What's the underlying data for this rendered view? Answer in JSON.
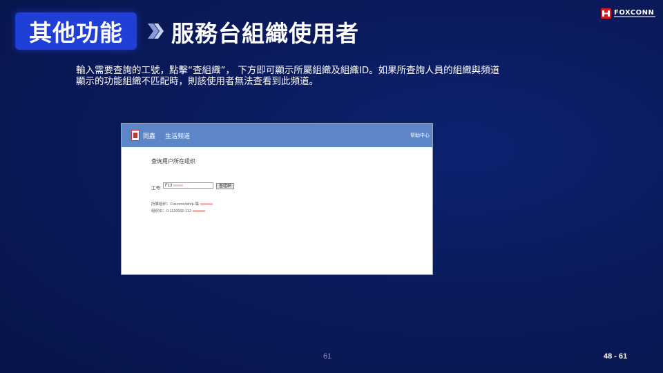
{
  "header": {
    "section_tag": "其他功能",
    "title": "服務台組織使用者",
    "brand": "FOXCONN"
  },
  "description": {
    "line1": "輸入需要查詢的工號，點擊“查組織”， 下方即可顯示所屬組織及組織ID。如果所查詢人員的組織與頻道",
    "line2": "顯示的功能組織不匹配時，則該使用者無法查看到此頻道。"
  },
  "screenshot": {
    "brand": "同鑫",
    "channel": "生活频道",
    "help": "帮助中心",
    "heading": "查询用户所在组织",
    "field_label": "工号:",
    "field_value": "F13",
    "button_label": "查组织",
    "result_org": "所属组织：Foxconn/wh/p-集",
    "result_id": "组织ID：0 1120000 112"
  },
  "footer": {
    "page_number": "61",
    "page_range": "48 - 61"
  },
  "colors": {
    "background": "#0a1a5c",
    "accent": "#1f3fd6",
    "screenshot_header": "#5c86c8",
    "logo_red": "#e0141b"
  }
}
